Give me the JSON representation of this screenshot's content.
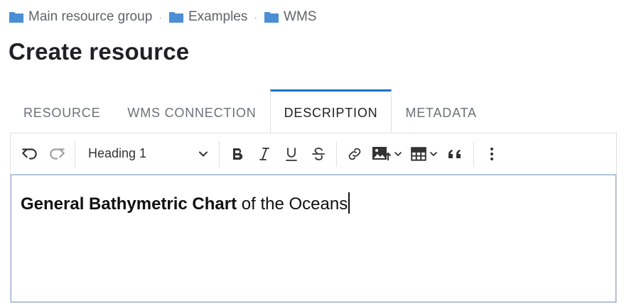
{
  "breadcrumb": {
    "items": [
      {
        "label": "Main resource group",
        "icon": "folder-icon"
      },
      {
        "label": "Examples",
        "icon": "folder-icon"
      },
      {
        "label": "WMS",
        "icon": "folder-icon"
      }
    ],
    "separator": "·",
    "folder_color": "#4a8fd4"
  },
  "page": {
    "title": "Create resource"
  },
  "tabs": [
    {
      "label": "RESOURCE",
      "active": false
    },
    {
      "label": "WMS CONNECTION",
      "active": false
    },
    {
      "label": "DESCRIPTION",
      "active": true
    },
    {
      "label": "METADATA",
      "active": false
    }
  ],
  "toolbar": {
    "heading_value": "Heading 1",
    "buttons": [
      "undo-icon",
      "redo-icon",
      "bold-icon",
      "italic-icon",
      "underline-icon",
      "strikethrough-icon",
      "link-icon",
      "insert-image-icon",
      "table-icon",
      "blockquote-icon",
      "more-vertical-icon"
    ]
  },
  "editor": {
    "content_bold": "General Bathymetric Chart",
    "content_regular": " of the Oceans"
  },
  "colors": {
    "accent": "#1a73c8",
    "focus_border": "#7fa8dd"
  }
}
